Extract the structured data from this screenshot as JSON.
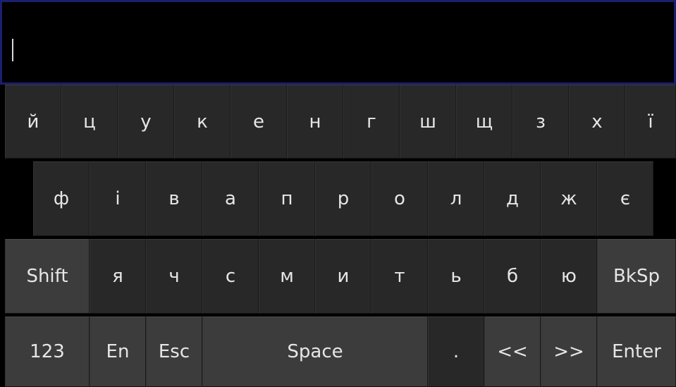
{
  "input": {
    "value": ""
  },
  "keyboard": {
    "row1": [
      "й",
      "ц",
      "у",
      "к",
      "е",
      "н",
      "г",
      "ш",
      "щ",
      "з",
      "х",
      "ї"
    ],
    "row2": [
      "ф",
      "і",
      "в",
      "а",
      "п",
      "р",
      "о",
      "л",
      "д",
      "ж",
      "є"
    ],
    "row3": {
      "shift": "Shift",
      "letters": [
        "я",
        "ч",
        "с",
        "м",
        "и",
        "т",
        "ь",
        "б",
        "ю"
      ],
      "backspace": "BkSp"
    },
    "row4": {
      "numbers": "123",
      "lang": "En",
      "esc": "Esc",
      "space": "Space",
      "dot": ".",
      "left": "<<",
      "right": ">>",
      "enter": "Enter"
    }
  }
}
